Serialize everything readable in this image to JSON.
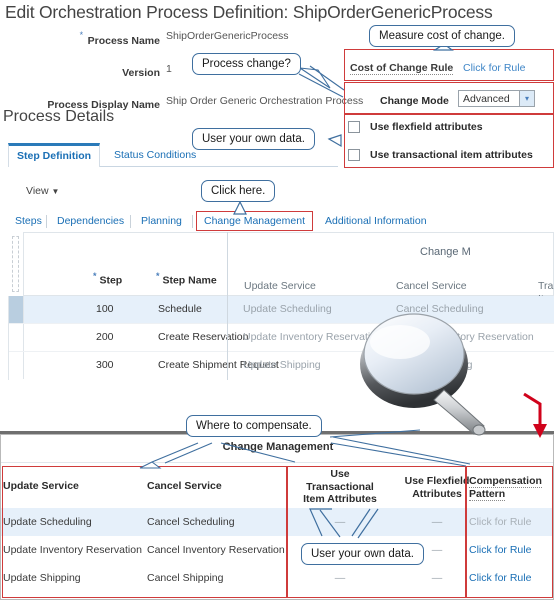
{
  "page": {
    "title": "Edit Orchestration Process Definition: ShipOrderGenericProcess"
  },
  "form": {
    "process_name_label": "Process Name",
    "process_name_value": "ShipOrderGenericProcess",
    "version_label": "Version",
    "version_value": "1",
    "display_name_label": "Process Display Name",
    "display_name_value": "Ship Order Generic Orchestration Process"
  },
  "right_panel": {
    "cost_of_change_rule_label": "Cost of Change Rule",
    "cost_of_change_rule_link": "Click for Rule",
    "change_mode_label": "Change Mode",
    "change_mode_value": "Advanced",
    "change_mode_caret": "chevron-down-icon",
    "flexfield_checkbox_label": "Use flexfield attributes",
    "transactional_checkbox_label": "Use transactional item attributes"
  },
  "section": {
    "title": "Process Details"
  },
  "tabs": [
    {
      "label": "Step Definition",
      "active": true
    },
    {
      "label": "Status Conditions",
      "active": false
    }
  ],
  "toolbar": {
    "view_label": "View",
    "view_caret": "▼"
  },
  "subtabs": [
    {
      "label": "Steps",
      "highlight": false
    },
    {
      "label": "Dependencies",
      "highlight": false
    },
    {
      "label": "Planning",
      "highlight": false
    },
    {
      "label": "Change Management",
      "highlight": true
    },
    {
      "label": "Additional Information",
      "highlight": false
    }
  ],
  "top_table": {
    "group_header": "Change M",
    "columns": [
      {
        "key": "step",
        "label": "Step",
        "required": true
      },
      {
        "key": "step_name",
        "label": "Step Name",
        "required": true
      },
      {
        "key": "update_service",
        "label": "Update Service",
        "required": false
      },
      {
        "key": "cancel_service",
        "label": "Cancel Service",
        "required": false
      },
      {
        "key": "transactional_item",
        "label": "Tra\nItem",
        "required": false
      }
    ],
    "rows": [
      {
        "step": "100",
        "step_name": "Schedule",
        "update_service": "Update Scheduling",
        "cancel_service": "Cancel Scheduling",
        "selected": true
      },
      {
        "step": "200",
        "step_name": "Create Reservation",
        "update_service": "Update Inventory Reservation",
        "cancel_service": "Cancel Inventory Reservation",
        "selected": false
      },
      {
        "step": "300",
        "step_name": "Create Shipment Request",
        "update_service": "Update Shipping",
        "cancel_service": "Cancel Shipping",
        "selected": false
      }
    ]
  },
  "bottom_table": {
    "group_header": "Change Management",
    "columns": [
      {
        "key": "update_service",
        "label": "Update Service"
      },
      {
        "key": "cancel_service",
        "label": "Cancel Service"
      },
      {
        "key": "use_transactional",
        "label": "Use\nTransactional\nItem Attributes"
      },
      {
        "key": "use_flexfield",
        "label": "Use Flexfield\nAttributes"
      },
      {
        "key": "compensation_pattern",
        "label": "Compensation\nPattern"
      }
    ],
    "rows": [
      {
        "update_service": "Update Scheduling",
        "cancel_service": "Cancel Scheduling",
        "use_transactional": "—",
        "use_flexfield": "—",
        "compensation_pattern": "Click for Rule",
        "compensation_muted": true,
        "selected": true
      },
      {
        "update_service": "Update Inventory Reservation",
        "cancel_service": "Cancel Inventory Reservation",
        "use_transactional": "—",
        "use_flexfield": "—",
        "compensation_pattern": "Click for Rule",
        "compensation_muted": false,
        "selected": false
      },
      {
        "update_service": "Update Shipping",
        "cancel_service": "Cancel Shipping",
        "use_transactional": "—",
        "use_flexfield": "—",
        "compensation_pattern": "Click for Rule",
        "compensation_muted": false,
        "selected": false
      }
    ]
  },
  "callouts": {
    "measure_cost": "Measure cost of change.",
    "process_change": "Process change?",
    "user_own_data_top": "User your own data.",
    "click_here": "Click here.",
    "where_to_compensate": "Where to compensate.",
    "user_own_data_bottom": "User your own data."
  },
  "annotations": {
    "magnifier": "magnifier-icon",
    "arrow": "red-down-arrow-icon"
  },
  "colors": {
    "accent": "#1a6fb5",
    "highlight_box": "#cf3b3b",
    "callout_border": "#3f6f9f",
    "selected_row": "#e6f0fa"
  }
}
